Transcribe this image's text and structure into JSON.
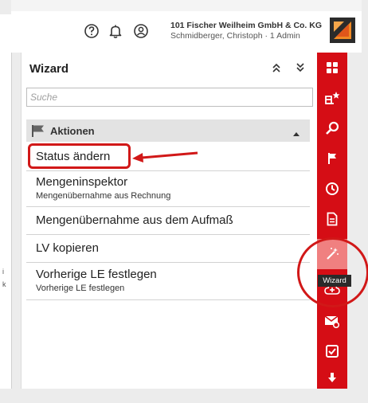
{
  "header": {
    "company_line": "101 Fischer Weilheim GmbH & Co. KG",
    "user_line": "Schmidberger, Christoph · 1 Admin",
    "icons": [
      "help-icon",
      "bell-icon",
      "user-icon",
      "logo-icon"
    ]
  },
  "wizard_panel": {
    "title": "Wizard",
    "search_placeholder": "Suche",
    "section": {
      "label": "Aktionen",
      "icon": "flag-icon",
      "state": "expanded"
    },
    "items": [
      {
        "title": "Status ändern",
        "subtitle": ""
      },
      {
        "title": "Mengeninspektor",
        "subtitle": "Mengenübernahme aus Rechnung"
      },
      {
        "title": "Mengenübernahme aus dem Aufmaß",
        "subtitle": ""
      },
      {
        "title": "LV kopieren",
        "subtitle": ""
      },
      {
        "title": "Vorherige LE festlegen",
        "subtitle": "Vorherige LE festlegen"
      }
    ]
  },
  "left_strip": {
    "marks": [
      "i",
      "k"
    ]
  },
  "right_rail": {
    "buttons": [
      {
        "name": "dashboard-icon",
        "active": false
      },
      {
        "name": "favorites-icon",
        "active": false
      },
      {
        "name": "search-icon",
        "active": false
      },
      {
        "name": "flag-icon",
        "active": false
      },
      {
        "name": "clock-icon",
        "active": false
      },
      {
        "name": "document-icon",
        "active": false
      },
      {
        "name": "wizard-icon",
        "active": true
      },
      {
        "name": "add-cloud-icon",
        "active": false
      },
      {
        "name": "mail-icon",
        "active": false
      },
      {
        "name": "checkbox-icon",
        "active": false
      },
      {
        "name": "download-icon",
        "active": false
      }
    ],
    "tooltip": "Wizard"
  },
  "colors": {
    "accent": "#d50d15",
    "active": "#f08080",
    "annotation": "#d11818"
  }
}
